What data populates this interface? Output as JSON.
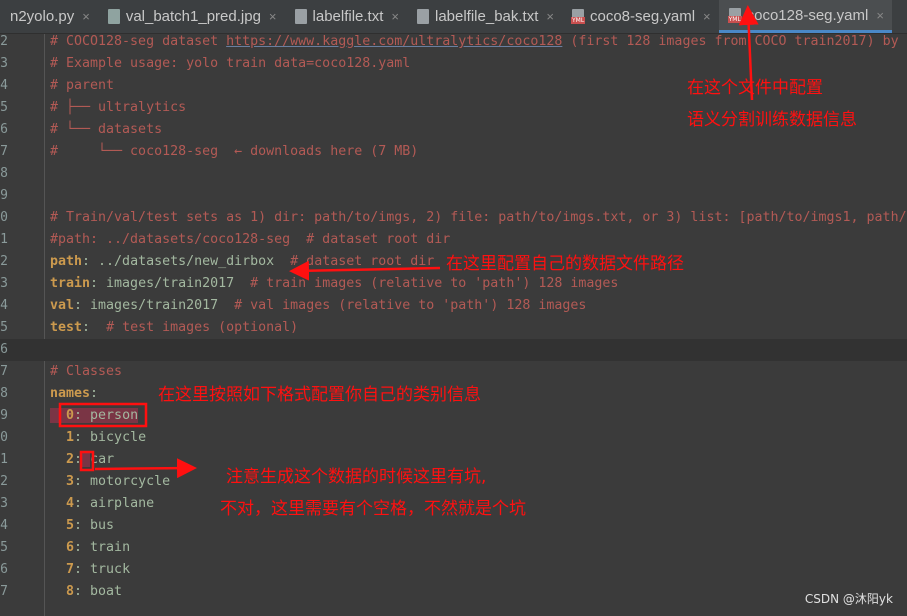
{
  "tabs": [
    {
      "label": "n2yolo.py",
      "icon": "python-file-icon"
    },
    {
      "label": "val_batch1_pred.jpg",
      "icon": "image-file-icon"
    },
    {
      "label": "labelfile.txt",
      "icon": "text-file-icon"
    },
    {
      "label": "labelfile_bak.txt",
      "icon": "text-file-icon"
    },
    {
      "label": "coco8-seg.yaml",
      "icon": "yaml-file-icon"
    },
    {
      "label": "coco128-seg.yaml",
      "icon": "yaml-file-icon",
      "active": true
    }
  ],
  "lines": [
    {
      "n": "2",
      "parts": [
        [
          "cm",
          "# COCO128-seg dataset "
        ],
        [
          "cm link",
          "https://www.kaggle.com/ultralytics/coco128"
        ],
        [
          "cm",
          " (first 128 images from COCO train2017) by"
        ]
      ]
    },
    {
      "n": "3",
      "parts": [
        [
          "cm",
          "# Example usage: yolo train data=coco128.yaml"
        ]
      ]
    },
    {
      "n": "4",
      "parts": [
        [
          "cm",
          "# parent"
        ]
      ]
    },
    {
      "n": "5",
      "parts": [
        [
          "cm",
          "# ├── ultralytics"
        ]
      ]
    },
    {
      "n": "6",
      "parts": [
        [
          "cm",
          "# └── datasets"
        ]
      ]
    },
    {
      "n": "7",
      "parts": [
        [
          "cm",
          "#     └── coco128-seg  ← downloads here (7 MB)"
        ]
      ]
    },
    {
      "n": "8",
      "parts": []
    },
    {
      "n": "9",
      "parts": []
    },
    {
      "n": "0",
      "parts": [
        [
          "cm",
          "# Train/val/test sets as 1) dir: path/to/imgs, 2) file: path/to/imgs.txt, or 3) list: [path/to/imgs1, path/"
        ]
      ]
    },
    {
      "n": "1",
      "parts": [
        [
          "cm",
          "#path: ../datasets/coco128-seg  # dataset root dir"
        ]
      ]
    },
    {
      "n": "2",
      "parts": [
        [
          "key",
          "path"
        ],
        [
          "val",
          ": ../datasets/new_dirbox  "
        ],
        [
          "cm",
          "# dataset root dir"
        ]
      ]
    },
    {
      "n": "3",
      "parts": [
        [
          "key",
          "train"
        ],
        [
          "val",
          ": images/train2017  "
        ],
        [
          "cm",
          "# train images (relative to 'path') 128 images"
        ]
      ]
    },
    {
      "n": "4",
      "parts": [
        [
          "key",
          "val"
        ],
        [
          "val",
          ": images/train2017  "
        ],
        [
          "cm",
          "# val images (relative to 'path') 128 images"
        ]
      ]
    },
    {
      "n": "5",
      "parts": [
        [
          "key",
          "test"
        ],
        [
          "val",
          ":  "
        ],
        [
          "cm",
          "# test images (optional)"
        ]
      ]
    },
    {
      "n": "6",
      "parts": [],
      "current": true
    },
    {
      "n": "7",
      "parts": [
        [
          "cm",
          "# Classes"
        ]
      ]
    },
    {
      "n": "8",
      "parts": [
        [
          "key",
          "names"
        ],
        [
          "val",
          ":"
        ]
      ]
    },
    {
      "n": "9",
      "parts": [
        [
          "sel",
          "  "
        ],
        [
          "sel key",
          "0"
        ],
        [
          "sel val",
          ": person"
        ]
      ]
    },
    {
      "n": "0",
      "parts": [
        [
          "val",
          "  "
        ],
        [
          "key",
          "1"
        ],
        [
          "val",
          ": bicycle"
        ]
      ]
    },
    {
      "n": "1",
      "parts": [
        [
          "val",
          "  "
        ],
        [
          "key",
          "2"
        ],
        [
          "val",
          ":"
        ],
        [
          "sel",
          " "
        ],
        [
          "val",
          "car"
        ]
      ]
    },
    {
      "n": "2",
      "parts": [
        [
          "val",
          "  "
        ],
        [
          "key",
          "3"
        ],
        [
          "val",
          ": motorcycle"
        ]
      ]
    },
    {
      "n": "3",
      "parts": [
        [
          "val",
          "  "
        ],
        [
          "key",
          "4"
        ],
        [
          "val",
          ": airplane"
        ]
      ]
    },
    {
      "n": "4",
      "parts": [
        [
          "val",
          "  "
        ],
        [
          "key",
          "5"
        ],
        [
          "val",
          ": bus"
        ]
      ]
    },
    {
      "n": "5",
      "parts": [
        [
          "val",
          "  "
        ],
        [
          "key",
          "6"
        ],
        [
          "val",
          ": train"
        ]
      ]
    },
    {
      "n": "6",
      "parts": [
        [
          "val",
          "  "
        ],
        [
          "key",
          "7"
        ],
        [
          "val",
          ": truck"
        ]
      ]
    },
    {
      "n": "7",
      "parts": [
        [
          "val",
          "  "
        ],
        [
          "key",
          "8"
        ],
        [
          "val",
          ": boat"
        ]
      ]
    }
  ],
  "annotations": {
    "file_line1": "在这个文件中配置",
    "file_line2": "语义分割训练数据信息",
    "path_note": "在这里配置自己的数据文件路径",
    "names_note": "在这里按照如下格式配置你自己的类别信息",
    "space_note1": "注意生成这个数据的时候这里有坑,",
    "space_note2": "不对，这里需要有个空格，不然就是个坑"
  },
  "watermark": "CSDN @沐阳yk",
  "colors": {
    "annotation": "#ff1010",
    "comment": "#b35a55",
    "key": "#cc9a4e",
    "value": "#a3b8a0",
    "active_tab_underline": "#4a88c7"
  }
}
